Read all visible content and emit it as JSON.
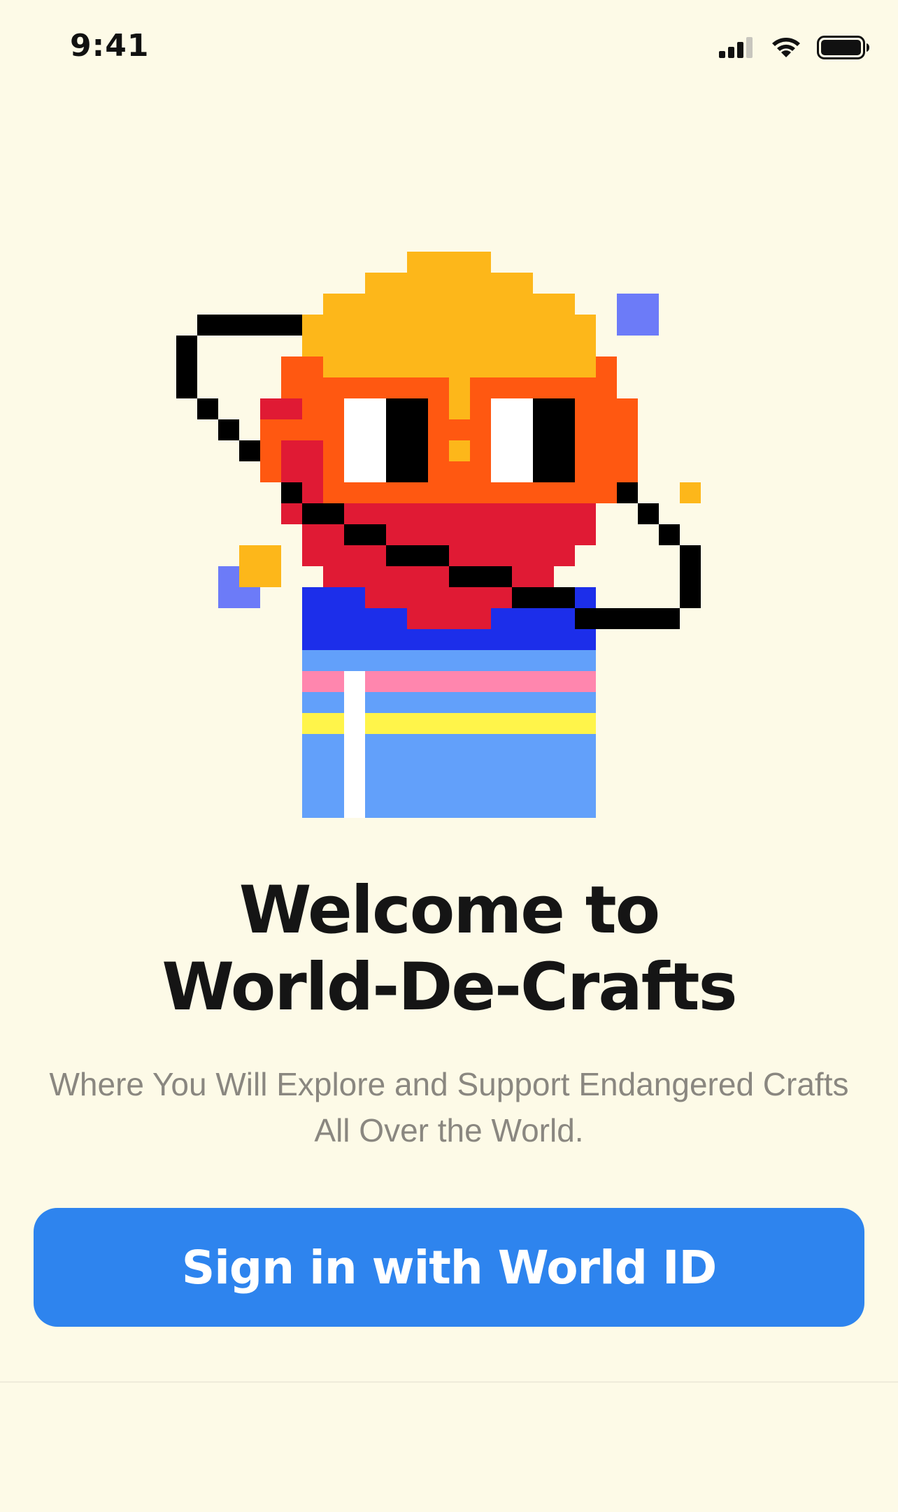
{
  "status_bar": {
    "time": "9:41"
  },
  "welcome": {
    "title_line1": "Welcome to",
    "title_line2": "World-De-Crafts",
    "subtitle_line1": "Where You Will Explore and Support Endangered Crafts",
    "subtitle_line2": "All Over the World."
  },
  "signin": {
    "label": "Sign in with World ID"
  },
  "colors": {
    "background": "#FDFAE7",
    "button": "#2E84EE",
    "button_text": "#FFFFFF",
    "title": "#151515",
    "subtitle": "#8A8780"
  },
  "icons": {
    "signal": "cellular-signal-icon",
    "wifi": "wifi-icon",
    "battery": "battery-icon",
    "mascot": "pixel-art-mascot"
  }
}
